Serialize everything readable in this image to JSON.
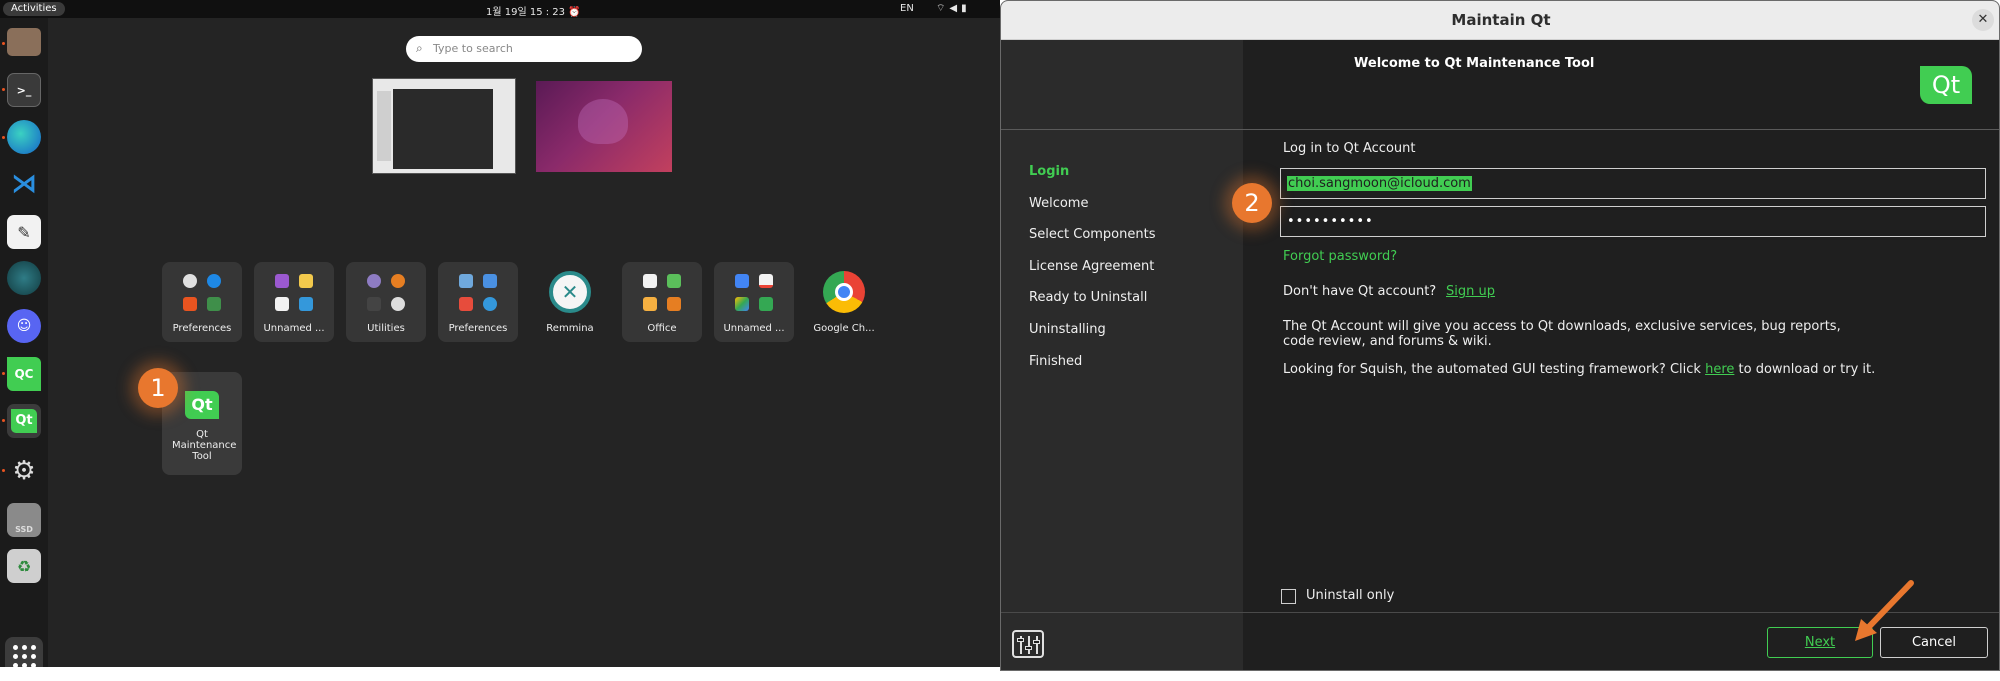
{
  "desktop": {
    "topbar": {
      "activities": "Activities",
      "clock": "1월 19일 15 : 23",
      "language": "EN"
    },
    "search": {
      "placeholder": "Type to search"
    },
    "app_grid": [
      {
        "label": "Preferences"
      },
      {
        "label": "Unnamed ..."
      },
      {
        "label": "Utilities"
      },
      {
        "label": "Preferences"
      },
      {
        "label": "Remmina"
      },
      {
        "label": "Office"
      },
      {
        "label": "Unnamed ..."
      },
      {
        "label": "Google Ch..."
      }
    ],
    "qt_tile_label": "Qt Maintenance Tool",
    "badge_1": "1",
    "dock_icons": [
      "files-icon",
      "terminal-icon",
      "edge-dev-icon",
      "vscode-icon",
      "app-icon",
      "gitkraken-icon",
      "discord-icon",
      "qt-creator-icon",
      "qt-maintenance-icon",
      "settings-icon",
      "ssd-icon",
      "trash-icon",
      "show-apps-icon"
    ]
  },
  "window": {
    "title": "Maintain Qt",
    "close": "✕",
    "welcome": "Welcome to Qt Maintenance Tool",
    "brand": "Qt",
    "steps": [
      {
        "label": "Login",
        "active": true
      },
      {
        "label": "Welcome",
        "active": false
      },
      {
        "label": "Select Components",
        "active": false
      },
      {
        "label": "License Agreement",
        "active": false
      },
      {
        "label": "Ready to Uninstall",
        "active": false
      },
      {
        "label": "Uninstalling",
        "active": false
      },
      {
        "label": "Finished",
        "active": false
      }
    ],
    "login_heading": "Log in to Qt Account",
    "email": "choi.sangmoon@icloud.com",
    "password": "••••••••••",
    "forgot": "Forgot password?",
    "no_account": "Don't have Qt account?",
    "sign_up": "Sign up",
    "info_line1": "The Qt Account will give you access to Qt downloads, exclusive services, bug reports,",
    "info_line2": "code review, and forums & wiki.",
    "squish_prefix": "Looking for Squish, the automated GUI testing framework? Click",
    "squish_link": "here",
    "squish_suffix": "to download or try it.",
    "uninstall_only": "Uninstall only",
    "next": "Next",
    "cancel": "Cancel",
    "badge_2": "2",
    "accent": "#41cd52"
  }
}
